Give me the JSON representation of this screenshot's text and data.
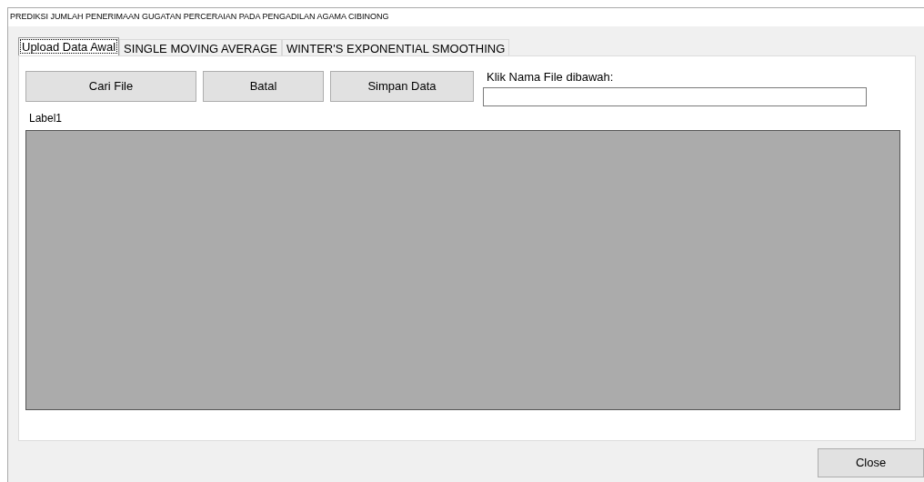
{
  "window": {
    "title": "PREDIKSI JUMLAH PENERIMAAN GUGATAN PERCERAIAN PADA PENGADILAN AGAMA CIBINONG"
  },
  "tabs": [
    {
      "label": "Upload Data Awal",
      "selected": true
    },
    {
      "label": "SINGLE MOVING AVERAGE",
      "selected": false
    },
    {
      "label": "WINTER'S EXPONENTIAL SMOOTHING",
      "selected": false
    }
  ],
  "buttons": [
    "Cari File",
    "Batal",
    "Simpan Data"
  ],
  "file_field": {
    "label": "Klik Nama File dibawah:"
  },
  "status_label": "Label1",
  "close_button": "Close"
}
